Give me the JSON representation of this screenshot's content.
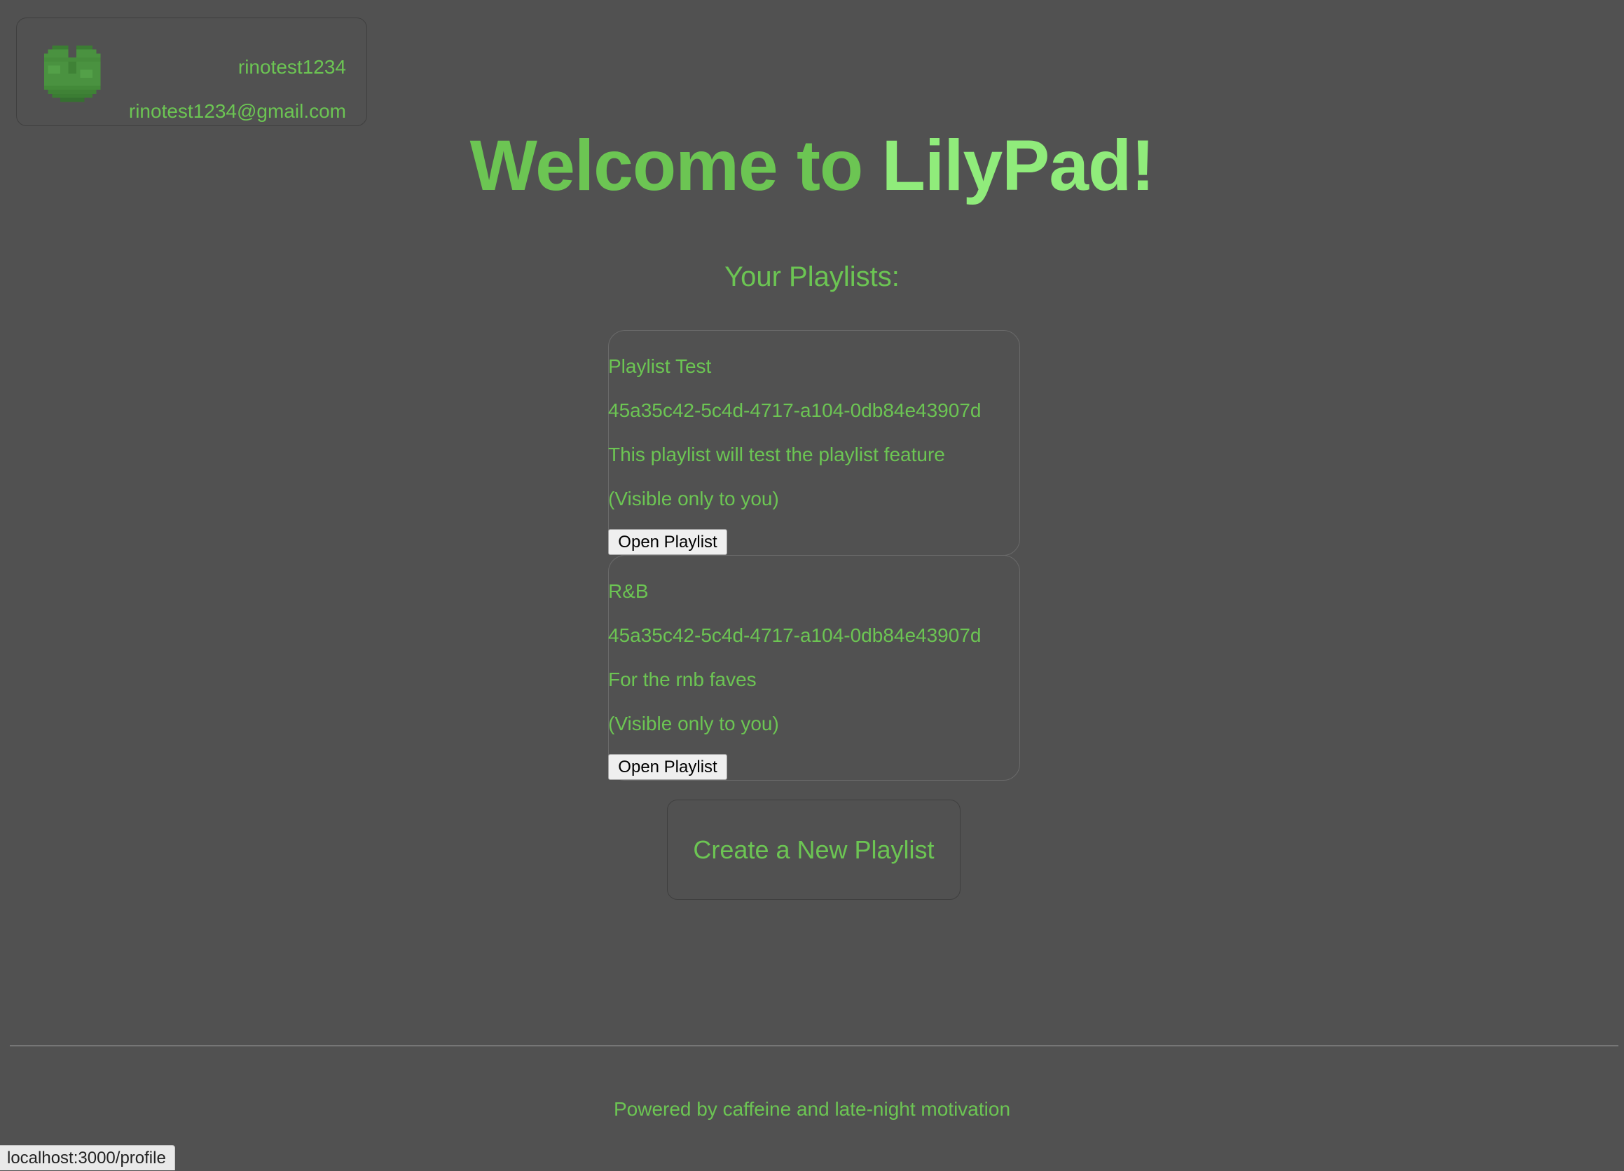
{
  "profile": {
    "avatar_icon": "lilypad-icon",
    "username": "rinotest1234",
    "email": "rinotest1234@gmail.com"
  },
  "header": {
    "welcome_part1": "Welcome to",
    "welcome_part2": "LilyPad!"
  },
  "playlists": {
    "heading": "Your Playlists:",
    "items": [
      {
        "name": "Playlist Test",
        "id": "45a35c42-5c4d-4717-a104-0db84e43907d",
        "description": "This playlist will test the playlist feature",
        "visibility": "(Visible only to you)",
        "button_label": "Open Playlist"
      },
      {
        "name": "R&B",
        "id": "45a35c42-5c4d-4717-a104-0db84e43907d",
        "description": "For the rnb faves",
        "visibility": "(Visible only to you)",
        "button_label": "Open Playlist"
      }
    ],
    "create_label": "Create a New Playlist"
  },
  "footer": {
    "text": "Powered by caffeine and late-night motivation"
  },
  "status_bar": {
    "url": "localhost:3000/profile"
  },
  "colors": {
    "background": "#515151",
    "text_green": "#6cc553",
    "accent_light_green": "#90ec7b"
  }
}
